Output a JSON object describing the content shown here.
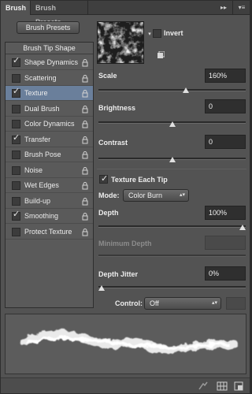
{
  "tabs": {
    "brush": "Brush",
    "brush_presets": "Brush Presets",
    "collapse_icon": "double-chevron-icon",
    "menu_icon": "panel-menu-icon"
  },
  "left": {
    "presets_button": "Brush Presets",
    "list_header": "Brush Tip Shape",
    "items": [
      {
        "label": "Shape Dynamics",
        "checked": true,
        "selected": false
      },
      {
        "label": "Scattering",
        "checked": false,
        "selected": false
      },
      {
        "label": "Texture",
        "checked": true,
        "selected": true
      },
      {
        "label": "Dual Brush",
        "checked": false,
        "selected": false
      },
      {
        "label": "Color Dynamics",
        "checked": false,
        "selected": false
      },
      {
        "label": "Transfer",
        "checked": true,
        "selected": false
      },
      {
        "label": "Brush Pose",
        "checked": false,
        "selected": false
      },
      {
        "label": "Noise",
        "checked": false,
        "selected": false
      },
      {
        "label": "Wet Edges",
        "checked": false,
        "selected": false
      },
      {
        "label": "Build-up",
        "checked": false,
        "selected": false
      },
      {
        "label": "Smoothing",
        "checked": true,
        "selected": false
      },
      {
        "label": "Protect Texture",
        "checked": false,
        "selected": false
      }
    ]
  },
  "texture": {
    "invert_label": "Invert",
    "invert_checked": false,
    "scale_label": "Scale",
    "scale_value": "160%",
    "scale_level": 0.6,
    "brightness_label": "Brightness",
    "brightness_value": "0",
    "brightness_level": 0.5,
    "contrast_label": "Contrast",
    "contrast_value": "0",
    "contrast_level": 0.5,
    "texture_each_tip_label": "Texture Each Tip",
    "texture_each_tip_checked": true,
    "mode_label": "Mode:",
    "mode_value": "Color Burn",
    "depth_label": "Depth",
    "depth_value": "100%",
    "depth_level": 1.0,
    "min_depth_label": "Minimum Depth",
    "min_depth_value": "",
    "depth_jitter_label": "Depth Jitter",
    "depth_jitter_value": "0%",
    "depth_jitter_level": 0.0,
    "control_label": "Control:",
    "control_value": "Off"
  },
  "colors": {
    "panel": "#535353",
    "selected_row": "#6a7f9b",
    "field_bg": "#2f2f2f"
  }
}
